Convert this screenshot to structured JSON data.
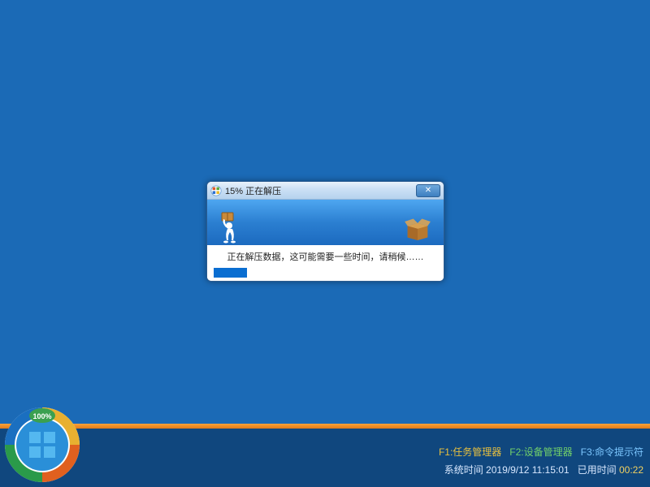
{
  "dialog": {
    "percent_label": "15% 正在解压",
    "status_text": "正在解压数据，这可能需要一些时间，请稍候……",
    "progress_percent": 15
  },
  "footer": {
    "f1_label": "F1:任务管理器",
    "f2_label": "F2:设备管理器",
    "f3_label": "F3:命令提示符",
    "systime_label": "系统时间",
    "systime_value": "2019/9/12 11:15:01",
    "elapsed_label": "已用时间",
    "elapsed_value": "00:22"
  },
  "badge": {
    "percent": "100%"
  }
}
